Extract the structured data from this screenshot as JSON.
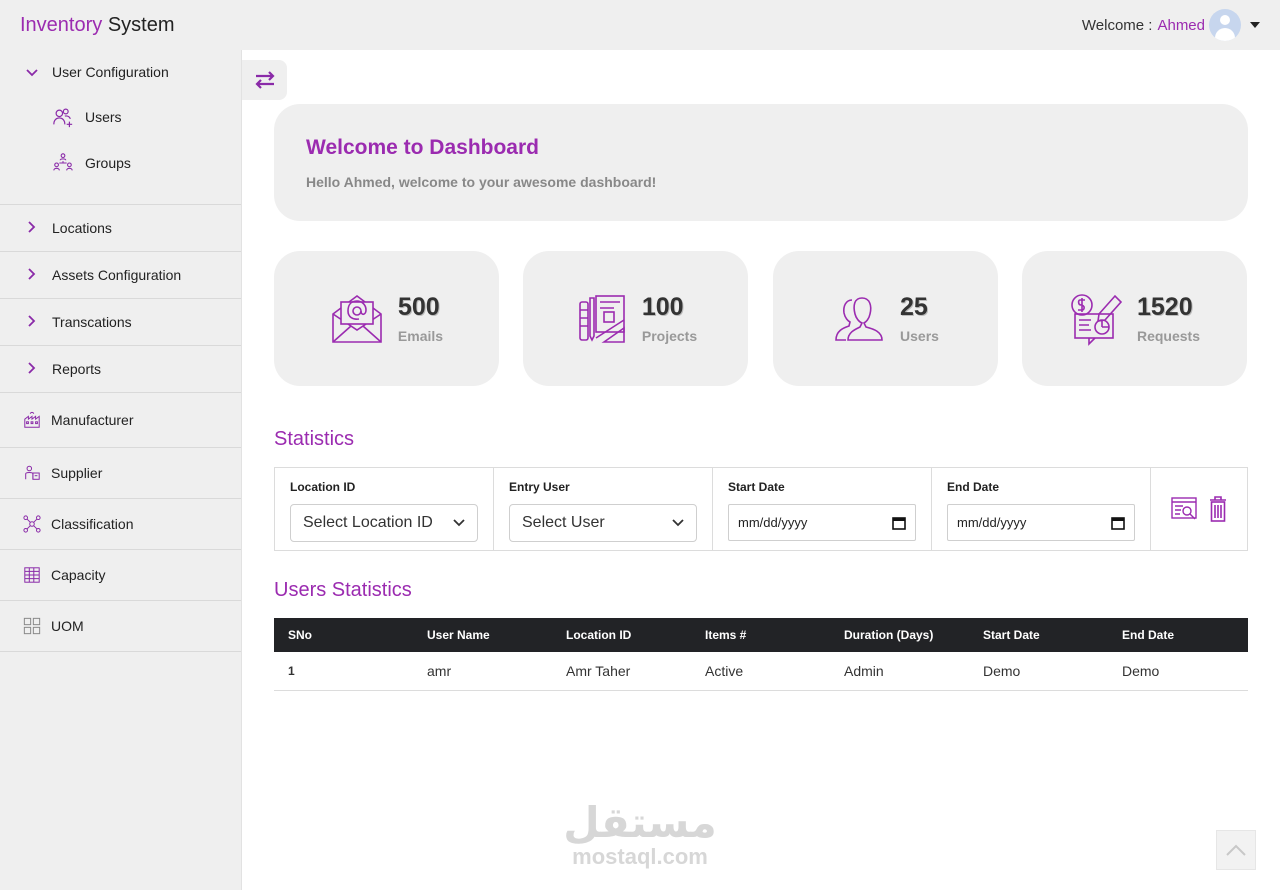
{
  "header": {
    "brand_part1": "Inventory",
    "brand_part2": "System",
    "welcome_label": "Welcome :",
    "user_name": "Ahmed"
  },
  "sidebar": {
    "user_config": {
      "label": "User Configuration",
      "children": [
        {
          "label": "Users",
          "icon": "add-user-icon"
        },
        {
          "label": "Groups",
          "icon": "groups-icon"
        }
      ]
    },
    "collapsed": [
      {
        "label": "Locations"
      },
      {
        "label": "Assets Configuration"
      },
      {
        "label": "Transcations"
      },
      {
        "label": "Reports"
      }
    ],
    "items": [
      {
        "label": "Manufacturer",
        "icon": "factory-icon"
      },
      {
        "label": "Supplier",
        "icon": "supplier-icon"
      },
      {
        "label": "Classification",
        "icon": "classification-icon"
      },
      {
        "label": "Capacity",
        "icon": "capacity-icon"
      },
      {
        "label": "UOM",
        "icon": "uom-icon"
      }
    ]
  },
  "welcome_card": {
    "title": "Welcome to Dashboard",
    "subtitle": "Hello Ahmed, welcome to your awesome dashboard!"
  },
  "stats": [
    {
      "value": "500",
      "label": "Emails",
      "icon": "email-icon"
    },
    {
      "value": "100",
      "label": "Projects",
      "icon": "projects-icon"
    },
    {
      "value": "25",
      "label": "Users",
      "icon": "users-icon"
    },
    {
      "value": "1520",
      "label": "Requests",
      "icon": "requests-icon"
    }
  ],
  "statistics": {
    "title": "Statistics",
    "location_label": "Location ID",
    "location_value": "Select Location ID",
    "entry_user_label": "Entry User",
    "entry_user_value": "Select User",
    "start_date_label": "Start Date",
    "start_date_value": "mm/dd/yyyy",
    "end_date_label": "End Date",
    "end_date_value": "mm/dd/yyyy"
  },
  "users_statistics": {
    "title": "Users Statistics",
    "columns": [
      "SNo",
      "User Name",
      "Location ID",
      "Items #",
      "Duration (Days)",
      "Start Date",
      "End Date"
    ],
    "rows": [
      [
        "1",
        "amr",
        "Amr Taher",
        "Active",
        "Admin",
        "Demo",
        "Demo"
      ]
    ]
  },
  "watermark": {
    "arabic": "مستقل",
    "latin": "mostaql.com"
  },
  "colors": {
    "accent": "#9b2bb0",
    "panel": "#efefef",
    "table_header": "#222326"
  }
}
